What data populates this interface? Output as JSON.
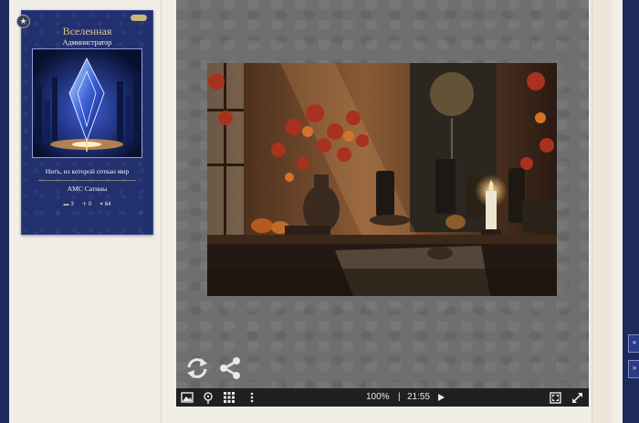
{
  "profile": {
    "title": "Вселенная",
    "role": "Администратор",
    "description": "Нить, из которой соткан мир",
    "group": "АМС Сатины",
    "stats": {
      "posts": "3",
      "plus": "0",
      "likes": "64"
    }
  },
  "player": {
    "zoom": "100%",
    "separator": "|",
    "time": "21:55"
  },
  "scroll": {
    "up": "«",
    "down": "»"
  }
}
